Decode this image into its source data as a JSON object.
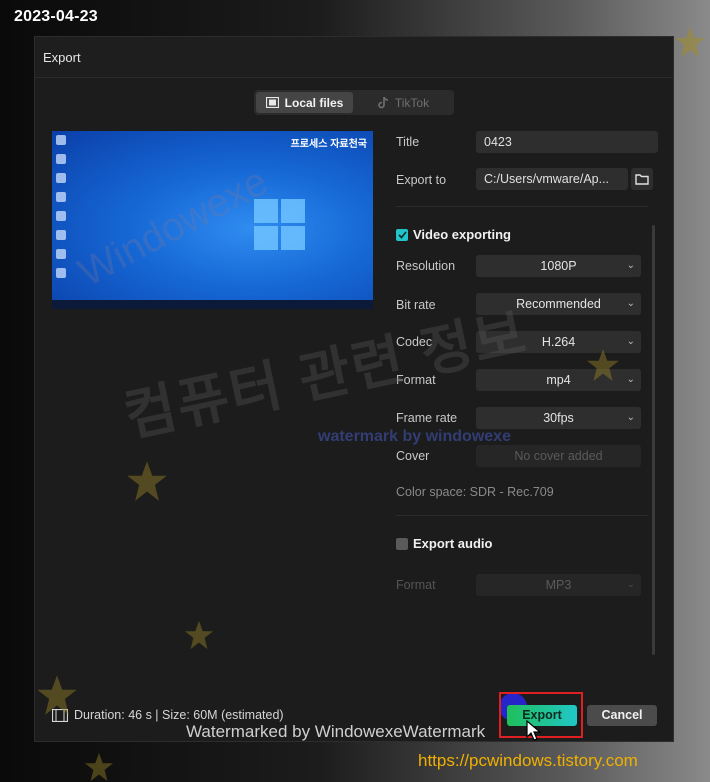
{
  "date_stamp": "2023-04-23",
  "dialog": {
    "title": "Export",
    "tabs": [
      {
        "label": "Local files",
        "active": true
      },
      {
        "label": "TikTok",
        "active": false
      }
    ],
    "preview": {
      "overlay_text": "프로세스 자료천국"
    },
    "fields": {
      "title_label": "Title",
      "title_value": "0423",
      "export_to_label": "Export to",
      "export_to_value": "C:/Users/vmware/Ap..."
    },
    "video": {
      "section_label": "Video exporting",
      "checked": true,
      "resolution_label": "Resolution",
      "resolution_value": "1080P",
      "bitrate_label": "Bit rate",
      "bitrate_value": "Recommended",
      "codec_label": "Codec",
      "codec_value": "H.264",
      "format_label": "Format",
      "format_value": "mp4",
      "framerate_label": "Frame rate",
      "framerate_value": "30fps",
      "cover_label": "Cover",
      "cover_value": "No cover added",
      "color_space": "Color space: SDR - Rec.709"
    },
    "audio": {
      "section_label": "Export audio",
      "checked": false,
      "format_label": "Format",
      "format_value": "MP3"
    },
    "footer": {
      "info": "Duration: 46 s | Size: 60M (estimated)",
      "export_label": "Export",
      "cancel_label": "Cancel"
    }
  },
  "watermarks": {
    "korean": "컴퓨터 관련 정보",
    "blue": "watermark by windowexe",
    "diagonal": "Windowexe",
    "bottom": "Watermarked by WindowexeWatermark",
    "site": "https://pcwindows.tistory.com"
  },
  "colors": {
    "accent_teal": "#22c3c9",
    "export_green": "#1fbf5a",
    "highlight_red": "#e02020",
    "site_orange": "#f0b000"
  }
}
